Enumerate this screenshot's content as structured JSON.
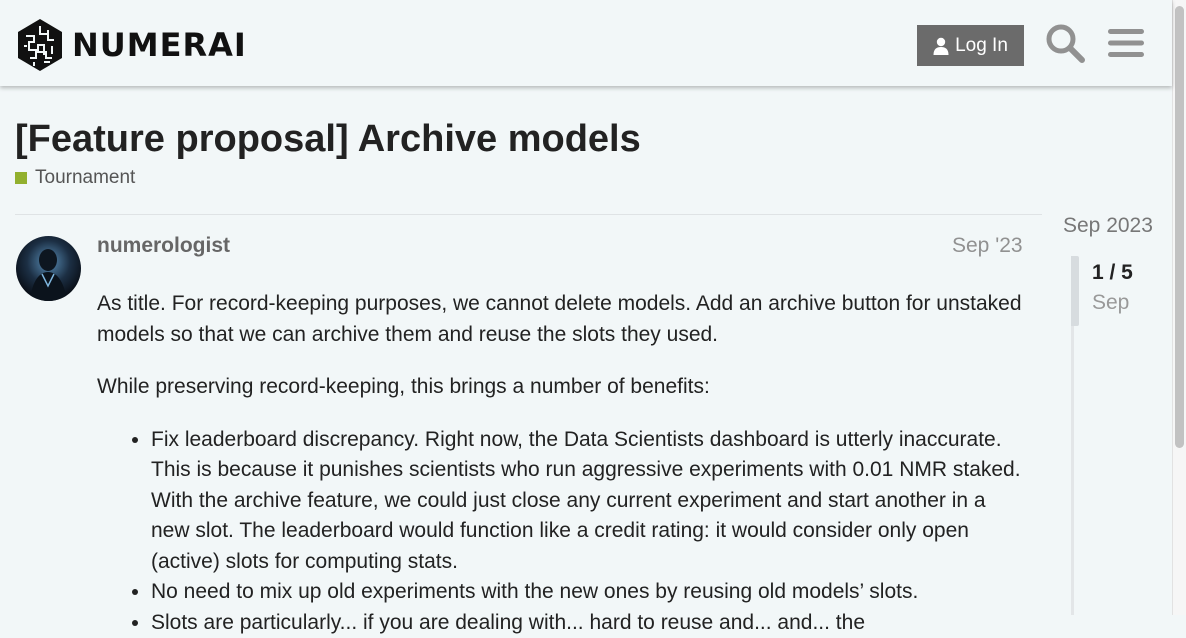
{
  "header": {
    "brand": "NUMERAI",
    "login_label": "Log In"
  },
  "topic": {
    "title": "[Feature proposal] Archive models",
    "category": "Tournament",
    "category_color": "#92b02e"
  },
  "post": {
    "username": "numerologist",
    "date": "Sep '23",
    "paragraphs": [
      "As title. For record-keeping purposes, we cannot delete models. Add an archive button for unstaked models so that we can archive them and reuse the slots they used.",
      "While preserving record-keeping, this brings a number of benefits:"
    ],
    "bullets": [
      "Fix leaderboard discrepancy. Right now, the Data Scientists dashboard is utterly inaccurate. This is because it punishes scientists who run aggressive experiments with 0.01 NMR staked. With the archive feature, we could just close any current experiment and start another in a new slot. The leaderboard would function like a credit rating: it would consider only open (active) slots for computing stats.",
      "No need to mix up old experiments with the new ones by reusing old models’ slots.",
      "Slots are particularly... if you are dealing with... hard to reuse and... and... the"
    ]
  },
  "timeline": {
    "start_date": "Sep 2023",
    "position": "1 / 5",
    "month": "Sep"
  },
  "icons": {
    "logo": "numerai-logo-icon",
    "user": "user-icon",
    "search": "search-icon",
    "menu": "hamburger-menu-icon"
  }
}
